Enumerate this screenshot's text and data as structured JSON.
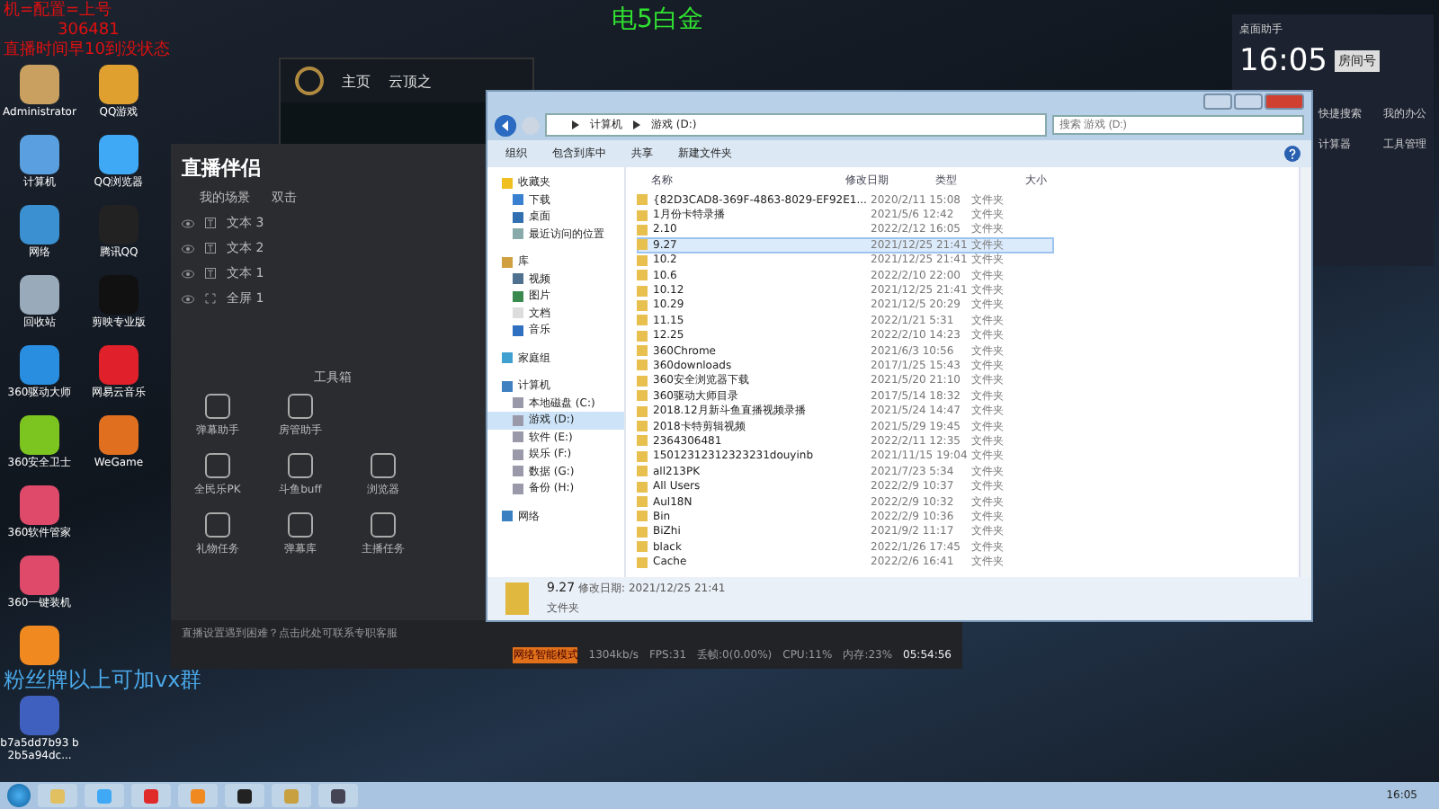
{
  "overlay_texts": {
    "red_lines": [
      "机=配置=上号",
      "306481",
      "直播时间早10到没状态"
    ],
    "blue_line": "粉丝牌以上可加vx群",
    "green_title": "电5白金"
  },
  "desktop_icons": [
    {
      "label": "Administrator",
      "kind": "user"
    },
    {
      "label": "QQ游戏",
      "kind": "game"
    },
    {
      "label": "计算机",
      "kind": "computer"
    },
    {
      "label": "QQ浏览器",
      "kind": "browser"
    },
    {
      "label": "网络",
      "kind": "network"
    },
    {
      "label": "腾讯QQ",
      "kind": "penguin"
    },
    {
      "label": "回收站",
      "kind": "bin"
    },
    {
      "label": "剪映专业版",
      "kind": "cut"
    },
    {
      "label": "360驱动大师",
      "kind": "blue"
    },
    {
      "label": "网易云音乐",
      "kind": "red"
    },
    {
      "label": "360安全卫士",
      "kind": "plus"
    },
    {
      "label": "WeGame",
      "kind": "wegame"
    },
    {
      "label": "360软件管家",
      "kind": "tiles"
    },
    {
      "kind": "none"
    },
    {
      "label": "360一键装机",
      "kind": "tiles"
    },
    {
      "kind": "none"
    },
    {
      "kind": "orange"
    },
    {
      "kind": "none"
    },
    {
      "label": "b7a5dd7b93 b2b5a94dc...",
      "kind": "bike"
    }
  ],
  "game_client": {
    "nav": [
      "主页",
      "云顶之"
    ]
  },
  "stream_app": {
    "title": "直播伴侣",
    "scene_tabs": [
      "我的场景",
      "双击"
    ],
    "scenes": [
      {
        "label": "文本 3",
        "kind": "text"
      },
      {
        "label": "文本 2",
        "kind": "text"
      },
      {
        "label": "文本 1",
        "kind": "text"
      },
      {
        "label": "全屏 1",
        "kind": "screen"
      }
    ],
    "toolbox_label": "工具箱",
    "tools": [
      {
        "label": "弹幕助手"
      },
      {
        "label": "房管助手"
      },
      {
        "kind": "blank"
      },
      {
        "label": "全民乐PK"
      },
      {
        "label": "斗鱼buff"
      },
      {
        "label": "浏览器"
      },
      {
        "label": "礼物任务"
      },
      {
        "label": "弹幕库"
      },
      {
        "label": "主播任务"
      }
    ],
    "notice": "直播设置遇到困难？点击此处可联系专职客服",
    "status": {
      "mode": "网络智能模式",
      "bitrate": "1304kb/s",
      "fps": "FPS:31",
      "dropped": "丢帧:0(0.00%)",
      "cpu": "CPU:11%",
      "memory": "内存:23%",
      "duration": "05:54:56"
    }
  },
  "explorer": {
    "path": [
      "计算机",
      "游戏 (D:)"
    ],
    "search_placeholder": "搜索 游戏 (D:)",
    "toolbar": [
      "组织",
      "包含到库中",
      "共享",
      "新建文件夹"
    ],
    "nav": [
      {
        "label": "收藏夹",
        "kind": "star",
        "children": [
          {
            "label": "下载",
            "kind": "download",
            "selected": false
          },
          {
            "label": "桌面",
            "kind": "desktop",
            "selected": false
          },
          {
            "label": "最近访问的位置",
            "kind": "recent",
            "selected": false
          }
        ],
        "selected": false
      },
      {
        "label": "库",
        "kind": "library",
        "children": [
          {
            "label": "视频",
            "kind": "video",
            "selected": false
          },
          {
            "label": "图片",
            "kind": "picture",
            "selected": false
          },
          {
            "label": "文档",
            "kind": "doc",
            "selected": false
          },
          {
            "label": "音乐",
            "kind": "music",
            "selected": false
          }
        ],
        "selected": false
      },
      {
        "label": "家庭组",
        "kind": "homegroup",
        "selected": false
      },
      {
        "label": "计算机",
        "kind": "computer",
        "children": [
          {
            "label": "本地磁盘 (C:)",
            "kind": "drive",
            "selected": false
          },
          {
            "label": "游戏 (D:)",
            "kind": "drive",
            "selected": true
          },
          {
            "label": "软件 (E:)",
            "kind": "drive",
            "selected": false
          },
          {
            "label": "娱乐 (F:)",
            "kind": "drive",
            "selected": false
          },
          {
            "label": "数据 (G:)",
            "kind": "drive",
            "selected": false
          },
          {
            "label": "备份 (H:)",
            "kind": "drive",
            "selected": false
          }
        ],
        "selected": false
      },
      {
        "label": "网络",
        "kind": "network",
        "selected": false
      }
    ],
    "columns": [
      "名称",
      "修改日期",
      "类型",
      "大小"
    ],
    "rows": [
      {
        "name": "{82D3CAD8-369F-4863-8029-EF92E1...",
        "date": "2020/2/11 15:08",
        "type": "文件夹",
        "selected": false
      },
      {
        "name": "1月份卡特录播",
        "date": "2021/5/6 12:42",
        "type": "文件夹",
        "selected": false
      },
      {
        "name": "2.10",
        "date": "2022/2/12 16:05",
        "type": "文件夹",
        "selected": false
      },
      {
        "name": "9.27",
        "date": "2021/12/25 21:41",
        "type": "文件夹",
        "selected": true
      },
      {
        "name": "10.2",
        "date": "2021/12/25 21:41",
        "type": "文件夹",
        "selected": false
      },
      {
        "name": "10.6",
        "date": "2022/2/10 22:00",
        "type": "文件夹",
        "selected": false
      },
      {
        "name": "10.12",
        "date": "2021/12/25 21:41",
        "type": "文件夹",
        "selected": false
      },
      {
        "name": "10.29",
        "date": "2021/12/5 20:29",
        "type": "文件夹",
        "selected": false
      },
      {
        "name": "11.15",
        "date": "2022/1/21 5:31",
        "type": "文件夹",
        "selected": false
      },
      {
        "name": "12.25",
        "date": "2022/2/10 14:23",
        "type": "文件夹",
        "selected": false
      },
      {
        "name": "360Chrome",
        "date": "2021/6/3 10:56",
        "type": "文件夹",
        "selected": false
      },
      {
        "name": "360downloads",
        "date": "2017/1/25 15:43",
        "type": "文件夹",
        "selected": false
      },
      {
        "name": "360安全浏览器下载",
        "date": "2021/5/20 21:10",
        "type": "文件夹",
        "selected": false
      },
      {
        "name": "360驱动大师目录",
        "date": "2017/5/14 18:32",
        "type": "文件夹",
        "selected": false
      },
      {
        "name": "2018.12月新斗鱼直播视频录播",
        "date": "2021/5/24 14:47",
        "type": "文件夹",
        "selected": false
      },
      {
        "name": "2018卡特剪辑视频",
        "date": "2021/5/29 19:45",
        "type": "文件夹",
        "selected": false
      },
      {
        "name": "2364306481",
        "date": "2022/2/11 12:35",
        "type": "文件夹",
        "selected": false
      },
      {
        "name": "15012312312323231douyinb",
        "date": "2021/11/15 19:04",
        "type": "文件夹",
        "selected": false
      },
      {
        "name": "all213PK",
        "date": "2021/7/23 5:34",
        "type": "文件夹",
        "selected": false
      },
      {
        "name": "All Users",
        "date": "2022/2/9 10:37",
        "type": "文件夹",
        "selected": false
      },
      {
        "name": "Aul18N",
        "date": "2022/2/9 10:32",
        "type": "文件夹",
        "selected": false
      },
      {
        "name": "Bin",
        "date": "2022/2/9 10:36",
        "type": "文件夹",
        "selected": false
      },
      {
        "name": "BiZhi",
        "date": "2021/9/2 11:17",
        "type": "文件夹",
        "selected": false
      },
      {
        "name": "black",
        "date": "2022/1/26 17:45",
        "type": "文件夹",
        "selected": false
      },
      {
        "name": "Cache",
        "date": "2022/2/6 16:41",
        "type": "文件夹",
        "selected": false
      }
    ],
    "details": {
      "name": "9.27",
      "date_label": "修改日期:",
      "date": "2021/12/25 21:41",
      "type": "文件夹"
    }
  },
  "widget": {
    "title": "桌面助手",
    "time": "16:05",
    "logo_text": "房间号",
    "tools": [
      "快捷搜索",
      "我的办公",
      "计算器",
      "工具管理"
    ]
  },
  "taskbar": {
    "clock": "16:05",
    "apps": [
      {
        "kind": "folder"
      },
      {
        "kind": "browser"
      },
      {
        "kind": "red"
      },
      {
        "kind": "orange"
      },
      {
        "kind": "penguin"
      },
      {
        "kind": "game"
      },
      {
        "kind": "ball"
      }
    ]
  }
}
